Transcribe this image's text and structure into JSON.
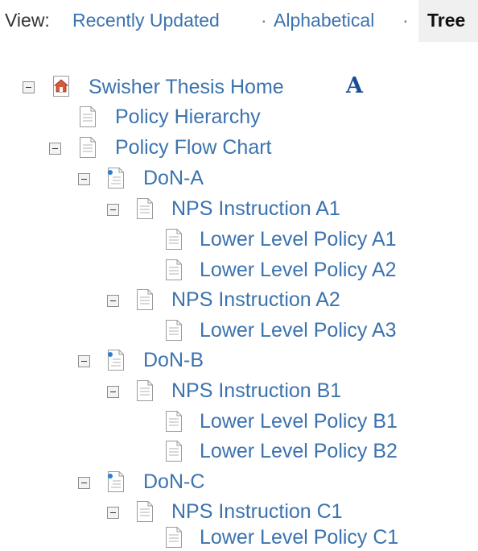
{
  "view_bar": {
    "prefix": "View:",
    "recent": "Recently Updated",
    "sep1": "·",
    "alpha": "Alphabetical",
    "sep2": "·",
    "tree": "Tree"
  },
  "tree": {
    "root": {
      "label": "Swisher Thesis Home",
      "icon": "home-page-icon",
      "edit_glyph": "A"
    },
    "nodes": [
      {
        "label": "Policy Hierarchy",
        "icon": "page-icon",
        "expandable": false
      },
      {
        "label": "Policy Flow Chart",
        "icon": "page-icon",
        "expandable": true
      },
      {
        "label": "DoN-A",
        "icon": "page-with-attachment-icon",
        "expandable": true
      },
      {
        "label": "NPS Instruction A1",
        "icon": "page-icon",
        "expandable": true
      },
      {
        "label": "Lower Level Policy A1",
        "icon": "page-icon",
        "expandable": false
      },
      {
        "label": "Lower Level Policy A2",
        "icon": "page-icon",
        "expandable": false
      },
      {
        "label": "NPS Instruction A2",
        "icon": "page-icon",
        "expandable": true
      },
      {
        "label": "Lower Level Policy A3",
        "icon": "page-icon",
        "expandable": false
      },
      {
        "label": "DoN-B",
        "icon": "page-with-attachment-icon",
        "expandable": true
      },
      {
        "label": "NPS Instruction B1",
        "icon": "page-icon",
        "expandable": true
      },
      {
        "label": "Lower Level Policy B1",
        "icon": "page-icon",
        "expandable": false
      },
      {
        "label": "Lower Level Policy B2",
        "icon": "page-icon",
        "expandable": false
      },
      {
        "label": "DoN-C",
        "icon": "page-with-attachment-icon",
        "expandable": true
      },
      {
        "label": "NPS Instruction C1",
        "icon": "page-icon",
        "expandable": true
      },
      {
        "label": "Lower Level Policy C1",
        "icon": "page-icon",
        "expandable": false
      }
    ]
  },
  "colors": {
    "link": "#3b73af",
    "text": "#333333",
    "current_tab_bg": "#f0f0f0"
  }
}
